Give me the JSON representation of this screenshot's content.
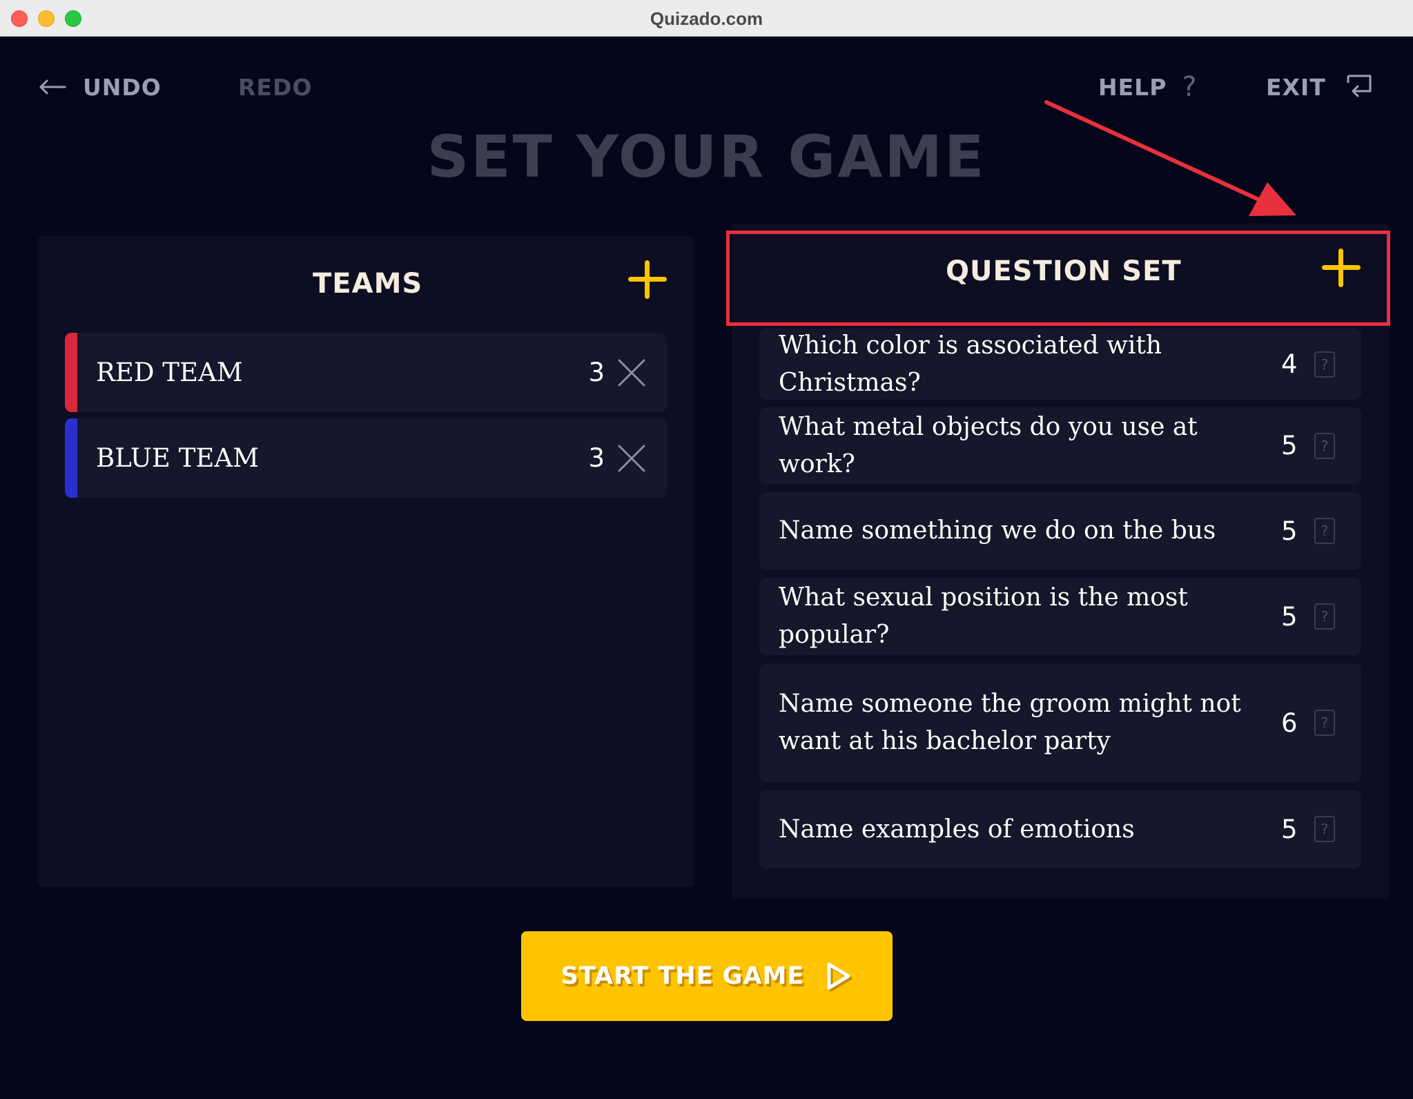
{
  "window": {
    "title": "Quizado.com"
  },
  "nav": {
    "undo_label": "UNDO",
    "redo_label": "REDO",
    "help_label": "HELP",
    "help_glyph": "?",
    "exit_label": "EXIT"
  },
  "page_title": "SET YOUR GAME",
  "teams": {
    "heading": "TEAMS",
    "items": [
      {
        "name": "RED TEAM",
        "count": "3",
        "color": "#d8283a"
      },
      {
        "name": "BLUE TEAM",
        "count": "3",
        "color": "#2a2fd0"
      }
    ]
  },
  "questions": {
    "heading": "QUESTION SET",
    "help_glyph": "?",
    "items": [
      {
        "text": "Which color is associated with Christmas?",
        "count": "4"
      },
      {
        "text": "What metal objects do you use at work?",
        "count": "5"
      },
      {
        "text": "Name something we do on the bus",
        "count": "5"
      },
      {
        "text": "What sexual position is the most popular?",
        "count": "5"
      },
      {
        "text": "Name someone the groom might not want at his bachelor party",
        "count": "6"
      },
      {
        "text": "Name examples of emotions",
        "count": "5"
      }
    ]
  },
  "start_button": {
    "label": "START THE GAME"
  },
  "colors": {
    "accent": "#ffc400",
    "background": "#05061a",
    "panel": "#0d0e21",
    "row": "#16172a",
    "annotation": "#e8303e"
  },
  "icons": [
    "arrow-left-icon",
    "question-mark-icon",
    "exit-icon",
    "plus-icon",
    "close-icon",
    "play-icon"
  ]
}
